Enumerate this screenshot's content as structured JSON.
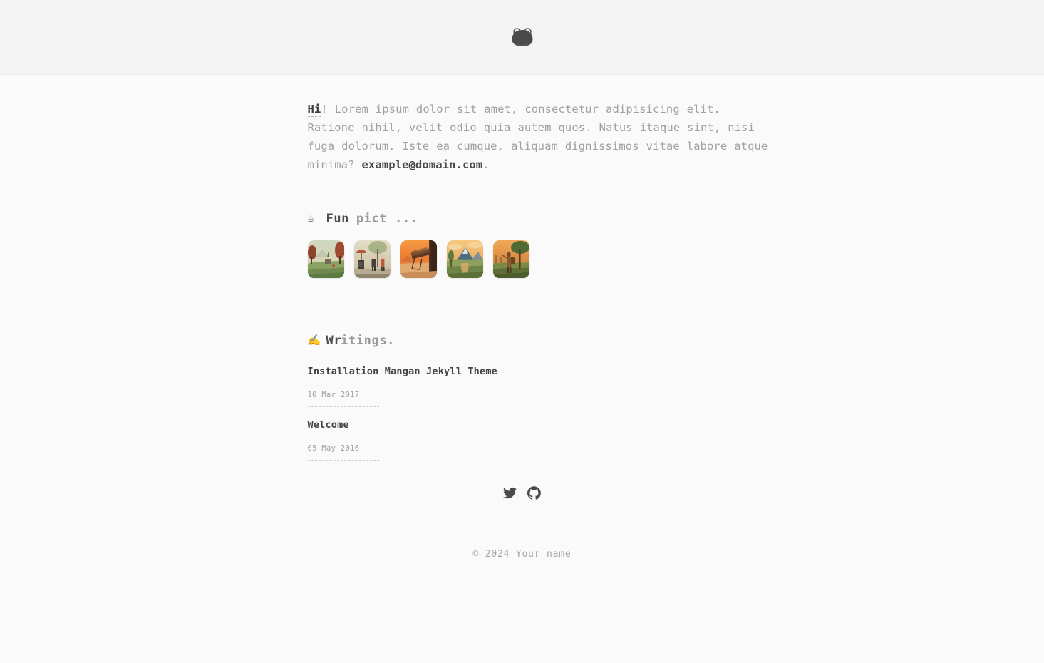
{
  "header": {
    "logo_alt": "Site logo",
    "logo_icon": "frog-head-icon"
  },
  "intro": {
    "greeting": "Hi",
    "greeting_suffix": "! ",
    "body": "Lorem ipsum dolor sit amet, consectetur adipisicing elit. Ratione nihil, velit odio quia autem quos. Natus itaque sint, nisi fuga dolorum. Iste ea cumque, aliquam dignissimos vitae labore atque minima? ",
    "email": "example@domain.com",
    "trailing": "."
  },
  "funpict": {
    "emoji": "☕",
    "emoji_name": "coffee-icon",
    "title_underlined": "Fun",
    "title_rest": " pict ...",
    "thumbnails": [
      {
        "alt": "Autumn valley with red trees and distant mountain",
        "palette": [
          "#b8c9b0",
          "#8f4433",
          "#d9cfa8",
          "#6f8a52"
        ]
      },
      {
        "alt": "Street scene with two figures under an awning",
        "palette": [
          "#d7cdb8",
          "#b4573a",
          "#7e8a6e",
          "#3b3b3b"
        ]
      },
      {
        "alt": "Orange desert cliff with wooden structure",
        "palette": [
          "#f08a3c",
          "#d9642c",
          "#5b3a22",
          "#e8b27a"
        ]
      },
      {
        "alt": "Mountain river valley at sunset",
        "palette": [
          "#f2c277",
          "#6d8fa8",
          "#8aa05e",
          "#e09a4e"
        ]
      },
      {
        "alt": "Traveler with backpack on a forest path",
        "palette": [
          "#e8a85c",
          "#4f5d3a",
          "#8a5a30",
          "#c98f52"
        ]
      }
    ]
  },
  "writings": {
    "emoji": "✍️",
    "emoji_name": "writing-hand-icon",
    "title_underlined": "Wr",
    "title_rest": "itings.",
    "posts": [
      {
        "title": "Installation Mangan Jekyll Theme",
        "date": "10 Mar 2017"
      },
      {
        "title": "Welcome",
        "date": "05 May 2016"
      }
    ]
  },
  "social": [
    {
      "name": "twitter-icon",
      "label": "Twitter"
    },
    {
      "name": "github-icon",
      "label": "GitHub"
    }
  ],
  "footer": {
    "copyright": "© 2024 Your name"
  },
  "colors": {
    "header_bg": "#f3f3f3",
    "body_bg": "#fafafa",
    "body_text": "#a0a0a0",
    "heading_text": "#4d4d4d",
    "icon": "#4a4a4a"
  }
}
